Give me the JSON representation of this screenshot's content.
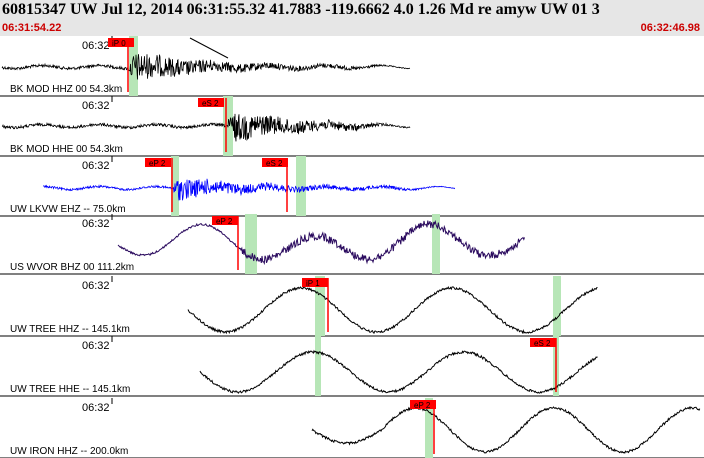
{
  "header": {
    "title": "60815347 UW Jul 12, 2014 06:31:55.32   41.7883 -119.6662  4.0 1.26 Md re amyw UW 01   3",
    "start_time": "06:31:54.22",
    "end_time": "06:32:46.98"
  },
  "colors": {
    "pick_red": "#ff0000",
    "window_green": "#b7e6b7",
    "trace_black": "#000000",
    "trace_blue": "#0000ff",
    "trace_purple": "#2a0a5e",
    "time_label_red": "#cc0000"
  },
  "traces": [
    {
      "label": "BK MOD HHZ 00 54.3km",
      "time_mark": "06:32",
      "color": "black",
      "picks": [
        {
          "label": "iP 0"
        }
      ]
    },
    {
      "label": "BK MOD HHE 00 54.3km",
      "time_mark": "06:32",
      "color": "black",
      "picks": [
        {
          "label": "eS 2"
        }
      ]
    },
    {
      "label": "UW LKVW EHZ -- 75.0km",
      "time_mark": "06:32",
      "color": "blue",
      "picks": [
        {
          "label": "eP 2"
        },
        {
          "label": "eS 2"
        }
      ]
    },
    {
      "label": "US WVOR BHZ 00 111.2km",
      "time_mark": "06:32",
      "color": "purple",
      "picks": [
        {
          "label": "eP 2"
        }
      ]
    },
    {
      "label": "UW TREE HHZ -- 145.1km",
      "time_mark": "06:32",
      "color": "black",
      "picks": [
        {
          "label": "iP 1"
        }
      ]
    },
    {
      "label": "UW TREE HHE -- 145.1km",
      "time_mark": "06:32",
      "color": "black",
      "picks": [
        {
          "label": "eS 2"
        }
      ]
    },
    {
      "label": "UW IRON HHZ -- 200.0km",
      "time_mark": "06:32",
      "color": "black",
      "picks": [
        {
          "label": "eP 2"
        }
      ]
    }
  ]
}
